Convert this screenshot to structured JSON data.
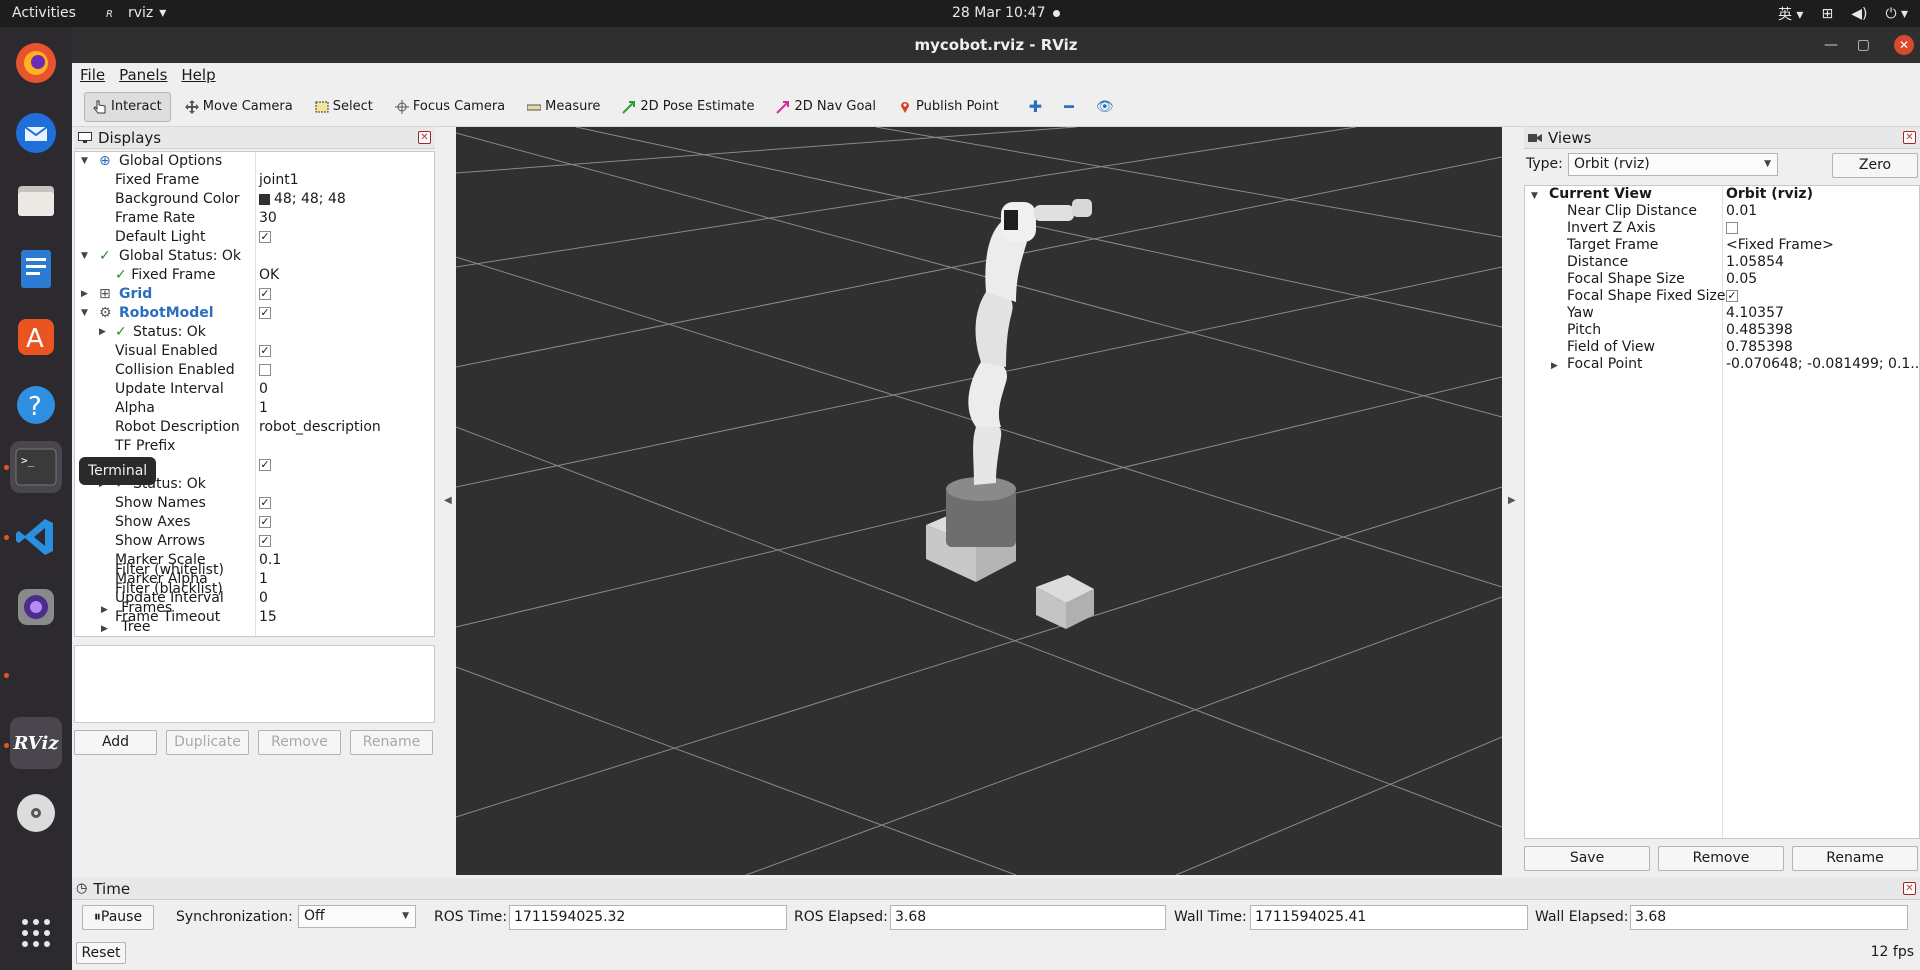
{
  "topbar": {
    "activities": "Activities",
    "app_name": "rviz",
    "clock": "28 Mar  10:47",
    "ime": "英"
  },
  "dock": {
    "tooltip": "Terminal",
    "rviz_label": "RViz"
  },
  "window": {
    "title": "mycobot.rviz - RViz",
    "menu": [
      "File",
      "Panels",
      "Help"
    ]
  },
  "toolbar": {
    "interact": "Interact",
    "move_camera": "Move Camera",
    "select": "Select",
    "focus_camera": "Focus Camera",
    "measure": "Measure",
    "pose_estimate": "2D Pose Estimate",
    "nav_goal": "2D Nav Goal",
    "publish_point": "Publish Point"
  },
  "displays": {
    "title": "Displays",
    "rows": {
      "global_options": "Global Options",
      "fixed_frame": "Fixed Frame",
      "fixed_frame_val": "joint1",
      "background_color": "Background Color",
      "background_color_val": "48; 48; 48",
      "frame_rate": "Frame Rate",
      "frame_rate_val": "30",
      "default_light": "Default Light",
      "global_status": "Global Status: Ok",
      "gs_fixed_frame": "Fixed Frame",
      "gs_fixed_frame_val": "OK",
      "grid": "Grid",
      "robot_model": "RobotModel",
      "status_ok": "Status: Ok",
      "visual_enabled": "Visual Enabled",
      "collision_enabled": "Collision Enabled",
      "update_interval": "Update Interval",
      "update_interval_val": "0",
      "alpha": "Alpha",
      "alpha_val": "1",
      "robot_description": "Robot Description",
      "robot_description_val": "robot_description",
      "tf_prefix": "TF Prefix",
      "tf_status": "Status: Ok",
      "show_names": "Show Names",
      "show_axes": "Show Axes",
      "show_arrows": "Show Arrows",
      "marker_scale": "Marker Scale",
      "marker_scale_val": "0.1",
      "marker_alpha": "Marker Alpha",
      "marker_alpha_val": "1",
      "tf_update_interval": "Update Interval",
      "tf_update_interval_val": "0",
      "frame_timeout": "Frame Timeout",
      "frame_timeout_val": "15",
      "filter_white": "Filter (whitelist)",
      "filter_black": "Filter (blacklist)",
      "frames": "Frames",
      "tree": "Tree"
    },
    "buttons": {
      "add": "Add",
      "duplicate": "Duplicate",
      "remove": "Remove",
      "rename": "Rename"
    }
  },
  "views": {
    "title": "Views",
    "type_label": "Type:",
    "type_value": "Orbit (rviz)",
    "zero": "Zero",
    "rows": {
      "current_view": "Current View",
      "current_view_val": "Orbit (rviz)",
      "near_clip": "Near Clip Distance",
      "near_clip_val": "0.01",
      "invert_z": "Invert Z Axis",
      "target_frame": "Target Frame",
      "target_frame_val": "<Fixed Frame>",
      "distance": "Distance",
      "distance_val": "1.05854",
      "focal_size": "Focal Shape Size",
      "focal_size_val": "0.05",
      "focal_fixed": "Focal Shape Fixed Size",
      "yaw": "Yaw",
      "yaw_val": "4.10357",
      "pitch": "Pitch",
      "pitch_val": "0.485398",
      "fov": "Field of View",
      "fov_val": "0.785398",
      "focal_point": "Focal Point",
      "focal_point_val": "-0.070648; -0.081499; 0.1..."
    },
    "buttons": {
      "save": "Save",
      "remove": "Remove",
      "rename": "Rename"
    }
  },
  "time": {
    "title": "Time",
    "pause": "Pause",
    "sync_label": "Synchronization:",
    "sync_value": "Off",
    "ros_time_label": "ROS Time:",
    "ros_time": "1711594025.32",
    "ros_elapsed_label": "ROS Elapsed:",
    "ros_elapsed": "3.68",
    "wall_time_label": "Wall Time:",
    "wall_time": "1711594025.41",
    "wall_elapsed_label": "Wall Elapsed:",
    "wall_elapsed": "3.68",
    "reset": "Reset",
    "fps": "12 fps"
  }
}
